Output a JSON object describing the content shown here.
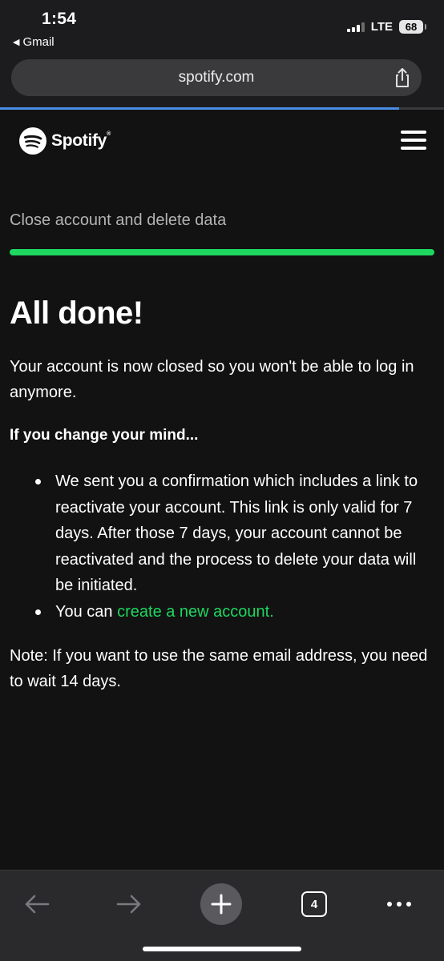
{
  "status_bar": {
    "time": "1:54",
    "back_app": "Gmail",
    "network": "LTE",
    "battery": "68"
  },
  "browser": {
    "url": "spotify.com",
    "open_tabs": "4"
  },
  "site": {
    "logo_text": "Spotify",
    "logo_mark": "®"
  },
  "page": {
    "step_title": "Close account and delete data",
    "headline": "All done!",
    "intro": "Your account is now closed so you won't be able to log in anymore.",
    "subhead": "If you change your mind...",
    "bullet_1": "We sent you a confirmation which includes a link to reactivate your account. This link is only valid for 7 days. After those 7 days, your account cannot be reactivated and the process to delete your data will be initiated.",
    "bullet_2_prefix": "You can ",
    "bullet_2_link": "create a new account.",
    "note": "Note: If you want to use the same email address, you need to wait 14 days."
  },
  "colors": {
    "accent": "#1ed760",
    "background": "#121212",
    "load_progress": "#4a8ee8"
  },
  "icons": [
    "signal-icon",
    "battery-icon",
    "share-icon",
    "spotify-logo-icon",
    "menu-icon",
    "back-arrow-icon",
    "forward-arrow-icon",
    "plus-icon",
    "tabs-icon",
    "more-icon"
  ]
}
